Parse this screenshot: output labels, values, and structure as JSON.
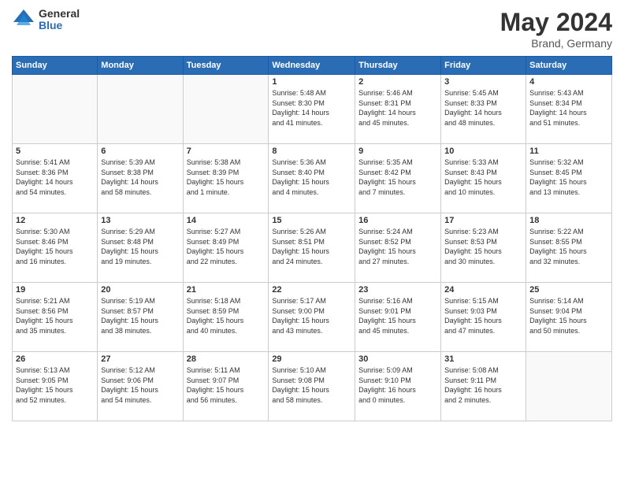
{
  "logo": {
    "general": "General",
    "blue": "Blue"
  },
  "title": {
    "month_year": "May 2024",
    "location": "Brand, Germany"
  },
  "headers": [
    "Sunday",
    "Monday",
    "Tuesday",
    "Wednesday",
    "Thursday",
    "Friday",
    "Saturday"
  ],
  "weeks": [
    [
      {
        "num": "",
        "info": ""
      },
      {
        "num": "",
        "info": ""
      },
      {
        "num": "",
        "info": ""
      },
      {
        "num": "1",
        "info": "Sunrise: 5:48 AM\nSunset: 8:30 PM\nDaylight: 14 hours\nand 41 minutes."
      },
      {
        "num": "2",
        "info": "Sunrise: 5:46 AM\nSunset: 8:31 PM\nDaylight: 14 hours\nand 45 minutes."
      },
      {
        "num": "3",
        "info": "Sunrise: 5:45 AM\nSunset: 8:33 PM\nDaylight: 14 hours\nand 48 minutes."
      },
      {
        "num": "4",
        "info": "Sunrise: 5:43 AM\nSunset: 8:34 PM\nDaylight: 14 hours\nand 51 minutes."
      }
    ],
    [
      {
        "num": "5",
        "info": "Sunrise: 5:41 AM\nSunset: 8:36 PM\nDaylight: 14 hours\nand 54 minutes."
      },
      {
        "num": "6",
        "info": "Sunrise: 5:39 AM\nSunset: 8:38 PM\nDaylight: 14 hours\nand 58 minutes."
      },
      {
        "num": "7",
        "info": "Sunrise: 5:38 AM\nSunset: 8:39 PM\nDaylight: 15 hours\nand 1 minute."
      },
      {
        "num": "8",
        "info": "Sunrise: 5:36 AM\nSunset: 8:40 PM\nDaylight: 15 hours\nand 4 minutes."
      },
      {
        "num": "9",
        "info": "Sunrise: 5:35 AM\nSunset: 8:42 PM\nDaylight: 15 hours\nand 7 minutes."
      },
      {
        "num": "10",
        "info": "Sunrise: 5:33 AM\nSunset: 8:43 PM\nDaylight: 15 hours\nand 10 minutes."
      },
      {
        "num": "11",
        "info": "Sunrise: 5:32 AM\nSunset: 8:45 PM\nDaylight: 15 hours\nand 13 minutes."
      }
    ],
    [
      {
        "num": "12",
        "info": "Sunrise: 5:30 AM\nSunset: 8:46 PM\nDaylight: 15 hours\nand 16 minutes."
      },
      {
        "num": "13",
        "info": "Sunrise: 5:29 AM\nSunset: 8:48 PM\nDaylight: 15 hours\nand 19 minutes."
      },
      {
        "num": "14",
        "info": "Sunrise: 5:27 AM\nSunset: 8:49 PM\nDaylight: 15 hours\nand 22 minutes."
      },
      {
        "num": "15",
        "info": "Sunrise: 5:26 AM\nSunset: 8:51 PM\nDaylight: 15 hours\nand 24 minutes."
      },
      {
        "num": "16",
        "info": "Sunrise: 5:24 AM\nSunset: 8:52 PM\nDaylight: 15 hours\nand 27 minutes."
      },
      {
        "num": "17",
        "info": "Sunrise: 5:23 AM\nSunset: 8:53 PM\nDaylight: 15 hours\nand 30 minutes."
      },
      {
        "num": "18",
        "info": "Sunrise: 5:22 AM\nSunset: 8:55 PM\nDaylight: 15 hours\nand 32 minutes."
      }
    ],
    [
      {
        "num": "19",
        "info": "Sunrise: 5:21 AM\nSunset: 8:56 PM\nDaylight: 15 hours\nand 35 minutes."
      },
      {
        "num": "20",
        "info": "Sunrise: 5:19 AM\nSunset: 8:57 PM\nDaylight: 15 hours\nand 38 minutes."
      },
      {
        "num": "21",
        "info": "Sunrise: 5:18 AM\nSunset: 8:59 PM\nDaylight: 15 hours\nand 40 minutes."
      },
      {
        "num": "22",
        "info": "Sunrise: 5:17 AM\nSunset: 9:00 PM\nDaylight: 15 hours\nand 43 minutes."
      },
      {
        "num": "23",
        "info": "Sunrise: 5:16 AM\nSunset: 9:01 PM\nDaylight: 15 hours\nand 45 minutes."
      },
      {
        "num": "24",
        "info": "Sunrise: 5:15 AM\nSunset: 9:03 PM\nDaylight: 15 hours\nand 47 minutes."
      },
      {
        "num": "25",
        "info": "Sunrise: 5:14 AM\nSunset: 9:04 PM\nDaylight: 15 hours\nand 50 minutes."
      }
    ],
    [
      {
        "num": "26",
        "info": "Sunrise: 5:13 AM\nSunset: 9:05 PM\nDaylight: 15 hours\nand 52 minutes."
      },
      {
        "num": "27",
        "info": "Sunrise: 5:12 AM\nSunset: 9:06 PM\nDaylight: 15 hours\nand 54 minutes."
      },
      {
        "num": "28",
        "info": "Sunrise: 5:11 AM\nSunset: 9:07 PM\nDaylight: 15 hours\nand 56 minutes."
      },
      {
        "num": "29",
        "info": "Sunrise: 5:10 AM\nSunset: 9:08 PM\nDaylight: 15 hours\nand 58 minutes."
      },
      {
        "num": "30",
        "info": "Sunrise: 5:09 AM\nSunset: 9:10 PM\nDaylight: 16 hours\nand 0 minutes."
      },
      {
        "num": "31",
        "info": "Sunrise: 5:08 AM\nSunset: 9:11 PM\nDaylight: 16 hours\nand 2 minutes."
      },
      {
        "num": "",
        "info": ""
      }
    ]
  ]
}
